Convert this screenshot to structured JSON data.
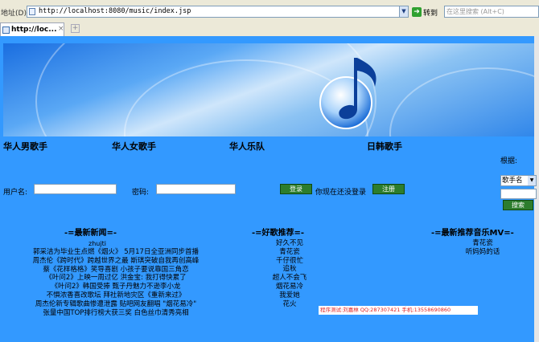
{
  "browser": {
    "address_label": "地址(D)",
    "url": "http://localhost:8080/music/index.jsp",
    "go_label": "转到",
    "search_placeholder": "在这里搜索 (Alt+C)",
    "tab_title": "http://loc...",
    "tab_close": "×",
    "new_tab": "+"
  },
  "nav": {
    "items": [
      "华人男歌手",
      "华人女歌手",
      "华人乐队",
      "日韩歌手"
    ]
  },
  "search_panel": {
    "label": "根据:",
    "select_value": "歌手名",
    "button_label": "搜索"
  },
  "login": {
    "user_label": "用户名:",
    "password_label": "密码:",
    "login_button": "登录",
    "status": "你现在还没登录",
    "register_button": "注册"
  },
  "news": {
    "title": "-=最新新闻=-",
    "author": "zhujti",
    "items": [
      "郭采洁为毕业生点燃《烟火》 5月17日全亚洲同步首播",
      "周杰伦《跨时代》跨越世界之最 斯琪突破自我再创高峰",
      "蔡《花样格格》笑导喜剧 小孩子要说靠国三角恋",
      "《叶问2》上映一周过亿 洪金宝: 我打得快累了",
      "《叶问2》韩国受捧 甄子丹魅力不逊李小龙",
      "不惧浓香喜改歌坛 拜社新地灾区《重新来过》",
      "周杰伦新专辑歌曲惨遭泄露 贴吧网友翻唱 \"烟花易冷\"",
      "张量中国TOP排行榜大获三奖 白色丝巾清秀亮相"
    ]
  },
  "songs": {
    "title": "-=好歌推荐=-",
    "items": [
      "好久不见",
      "青花瓷",
      "千仔很忙",
      "追秋",
      "超人不会飞",
      "烟花易冷",
      "我爱她",
      "花火"
    ]
  },
  "mv": {
    "title": "-=最新推荐音乐MV=-",
    "items": [
      "青花瓷",
      "听妈妈的话"
    ]
  },
  "credit": "程序测试:刘嘉林 QQ:287307421 手机:13558690860",
  "colors": {
    "page_bg": "#3399ff",
    "button_green": "#2d7d2d",
    "credit_red": "#e02020"
  }
}
